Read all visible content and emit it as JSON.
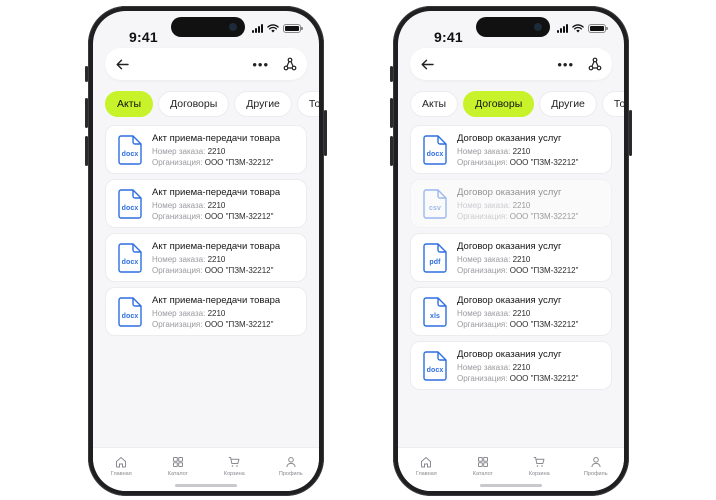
{
  "status": {
    "time": "9:41"
  },
  "icons": {
    "back": "arrow-left-icon",
    "more": "more-dots-icon",
    "share": "share-nodes-icon",
    "more_glyph": "•••"
  },
  "colors": {
    "accent": "#c8f22a",
    "file_blue": "#2e6fe0",
    "muted": "#9a9aa0"
  },
  "left": {
    "tabs": [
      {
        "label": "Акты",
        "active": true
      },
      {
        "label": "Договоры",
        "active": false
      },
      {
        "label": "Другие",
        "active": false
      },
      {
        "label": "Товары р",
        "active": false
      }
    ],
    "cards": [
      {
        "ext": "docx",
        "title": "Акт приема-передачи товара",
        "order_label": "Номер заказа:",
        "order": "2210",
        "org_label": "Организация:",
        "org": "ООО \"ПЗМ-32212\""
      },
      {
        "ext": "docx",
        "title": "Акт приема-передачи товара",
        "order_label": "Номер заказа:",
        "order": "2210",
        "org_label": "Организация:",
        "org": "ООО \"ПЗМ-32212\""
      },
      {
        "ext": "docx",
        "title": "Акт приема-передачи товара",
        "order_label": "Номер заказа:",
        "order": "2210",
        "org_label": "Организация:",
        "org": "ООО \"ПЗМ-32212\""
      },
      {
        "ext": "docx",
        "title": "Акт приема-передачи товара",
        "order_label": "Номер заказа:",
        "order": "2210",
        "org_label": "Организация:",
        "org": "ООО \"ПЗМ-32212\""
      }
    ]
  },
  "right": {
    "tabs": [
      {
        "label": "Акты",
        "active": false
      },
      {
        "label": "Договоры",
        "active": true
      },
      {
        "label": "Другие",
        "active": false
      },
      {
        "label": "Товары р",
        "active": false
      }
    ],
    "cards": [
      {
        "ext": "docx",
        "title": "Договор оказания услуг",
        "order_label": "Номер заказа:",
        "order": "2210",
        "org_label": "Организация:",
        "org": "ООО \"ПЗМ-32212\"",
        "dim": false
      },
      {
        "ext": "csv",
        "title": "Договор оказания услуг",
        "order_label": "Номер заказа:",
        "order": "2210",
        "org_label": "Организация:",
        "org": "ООО \"ПЗМ-32212\"",
        "dim": true
      },
      {
        "ext": "pdf",
        "title": "Договор оказания услуг",
        "order_label": "Номер заказа:",
        "order": "2210",
        "org_label": "Организация:",
        "org": "ООО \"ПЗМ-32212\"",
        "dim": false
      },
      {
        "ext": "xls",
        "title": "Договор оказания услуг",
        "order_label": "Номер заказа:",
        "order": "2210",
        "org_label": "Организация:",
        "org": "ООО \"ПЗМ-32212\"",
        "dim": false
      },
      {
        "ext": "docx",
        "title": "Договор оказания услуг",
        "order_label": "Номер заказа:",
        "order": "2210",
        "org_label": "Организация:",
        "org": "ООО \"ПЗМ-32212\"",
        "dim": false
      }
    ]
  },
  "nav": [
    {
      "label": "Главная",
      "icon": "home-icon"
    },
    {
      "label": "Каталог",
      "icon": "catalog-icon"
    },
    {
      "label": "Корзина",
      "icon": "cart-icon"
    },
    {
      "label": "Профиль",
      "icon": "profile-icon"
    }
  ]
}
